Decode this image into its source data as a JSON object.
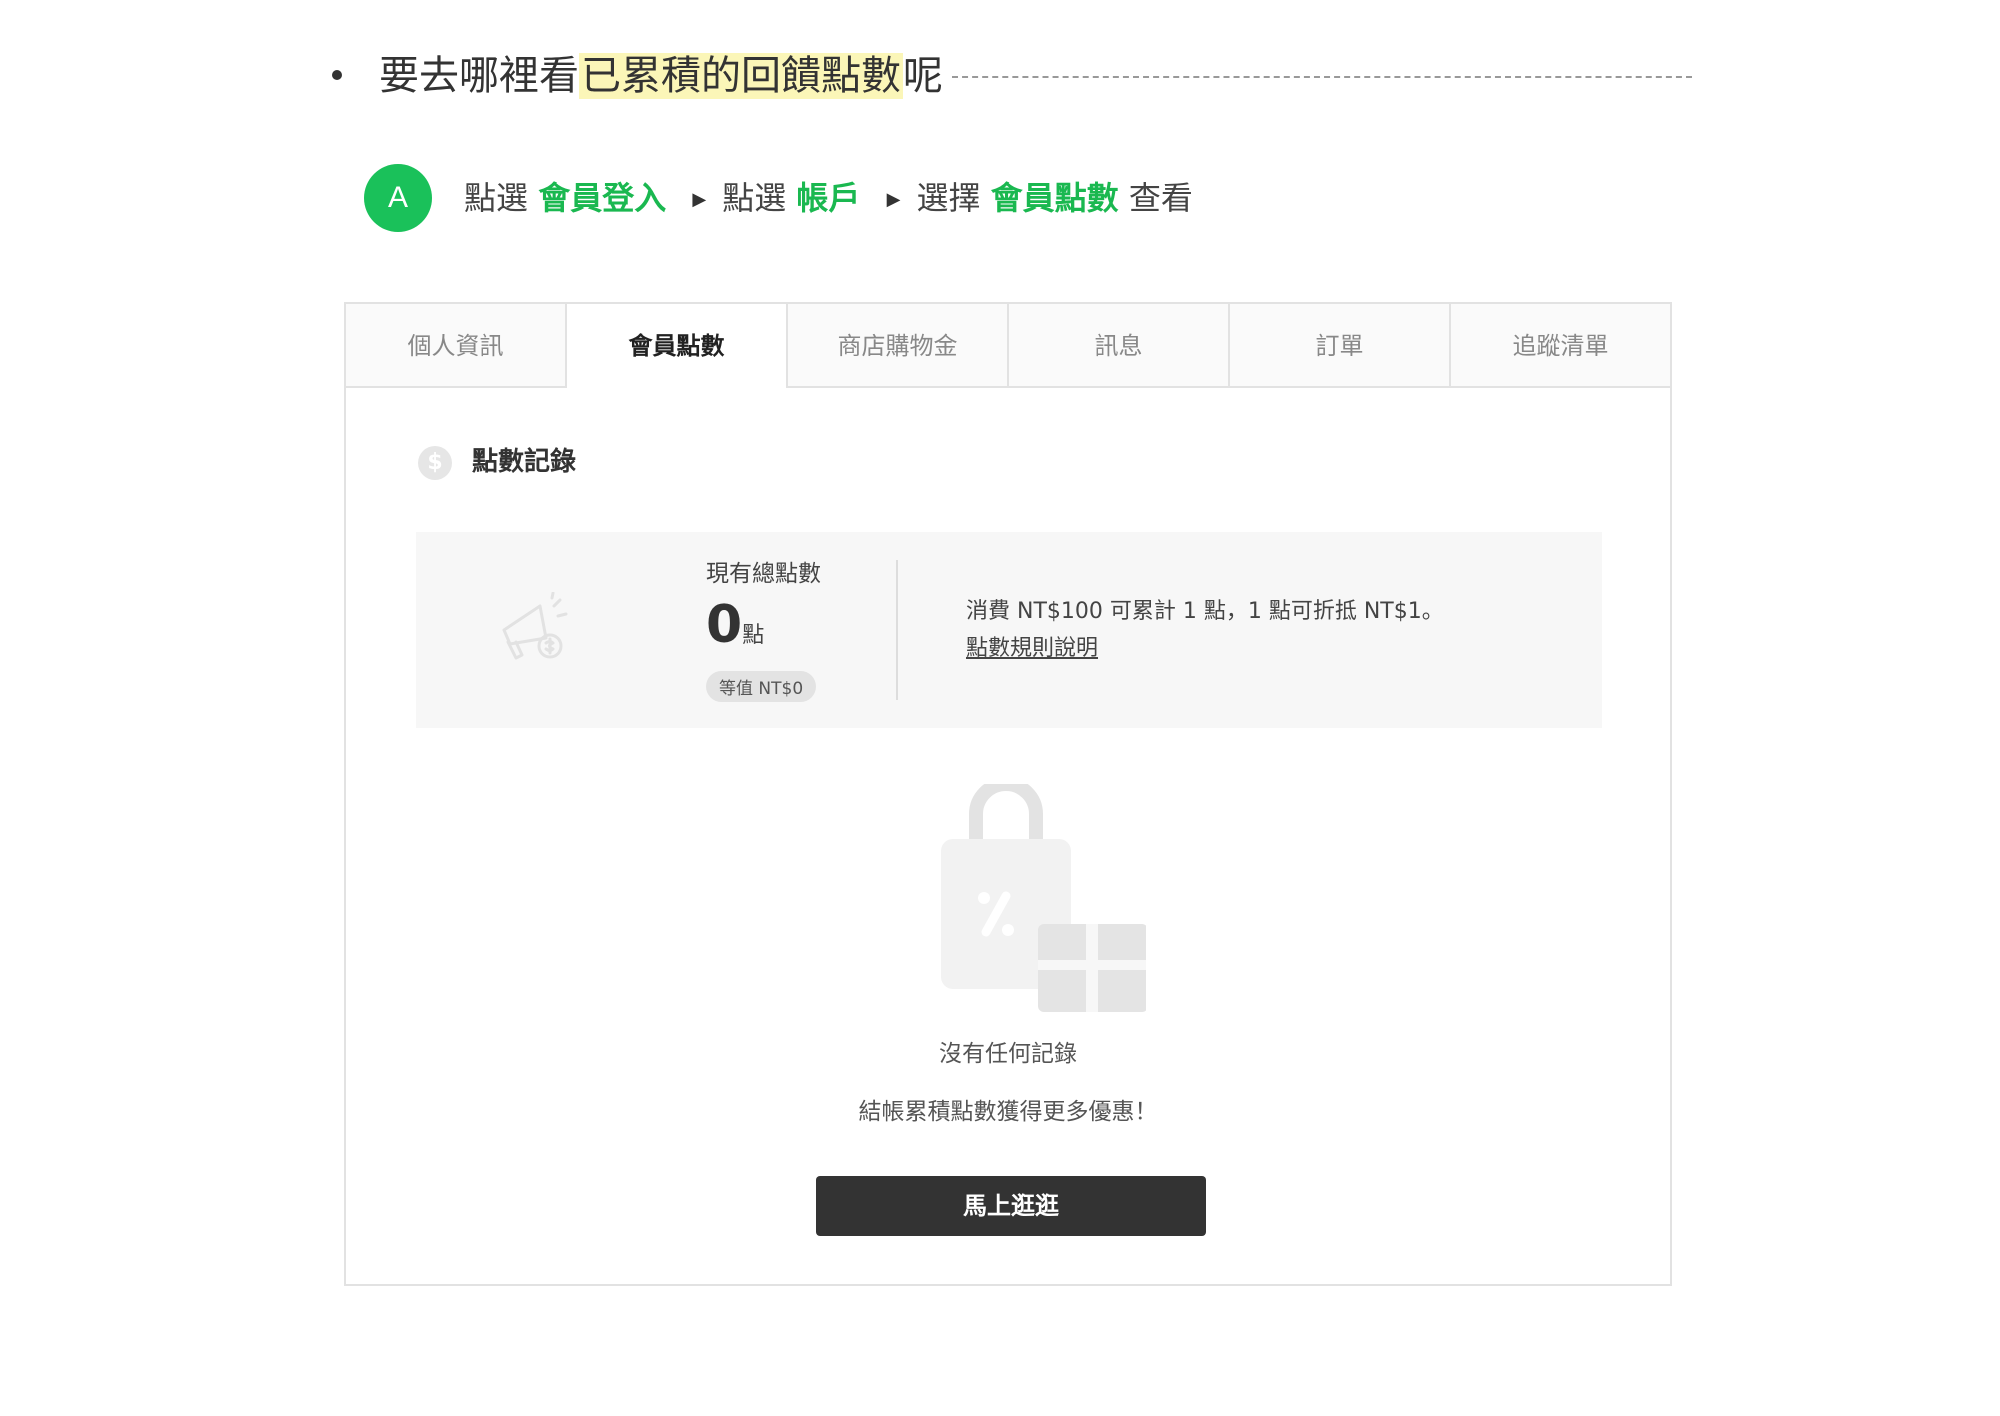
{
  "faq": {
    "question_pre": "要去哪裡看",
    "question_highlight": "已累積的回饋點數",
    "question_post": "呢"
  },
  "step": {
    "badge": "A",
    "parts": [
      "點選",
      "會員登入",
      "點選",
      "帳戶",
      "選擇",
      "會員點數",
      "查看"
    ],
    "arrow": "▶"
  },
  "tabs": [
    {
      "label": "個人資訊",
      "active": false
    },
    {
      "label": "會員點數",
      "active": true
    },
    {
      "label": "商店購物金",
      "active": false
    },
    {
      "label": "訊息",
      "active": false
    },
    {
      "label": "訂單",
      "active": false
    },
    {
      "label": "追蹤清單",
      "active": false
    }
  ],
  "points": {
    "section_title": "點數記錄",
    "dollar_glyph": "$",
    "total_label": "現有總點數",
    "total_value": "0",
    "unit": "點",
    "equivalent": "等值 NT$0",
    "rule_text": "消費 NT$100 可累計 1 點，1 點可折抵 NT$1。",
    "rule_link": "點數規則說明"
  },
  "empty": {
    "title": "沒有任何記錄",
    "subtitle": "結帳累積點數獲得更多優惠！",
    "button": "馬上逛逛"
  },
  "colors": {
    "accent_green": "#1ac15a",
    "highlight": "#fbf6b8",
    "button_dark": "#333333"
  }
}
